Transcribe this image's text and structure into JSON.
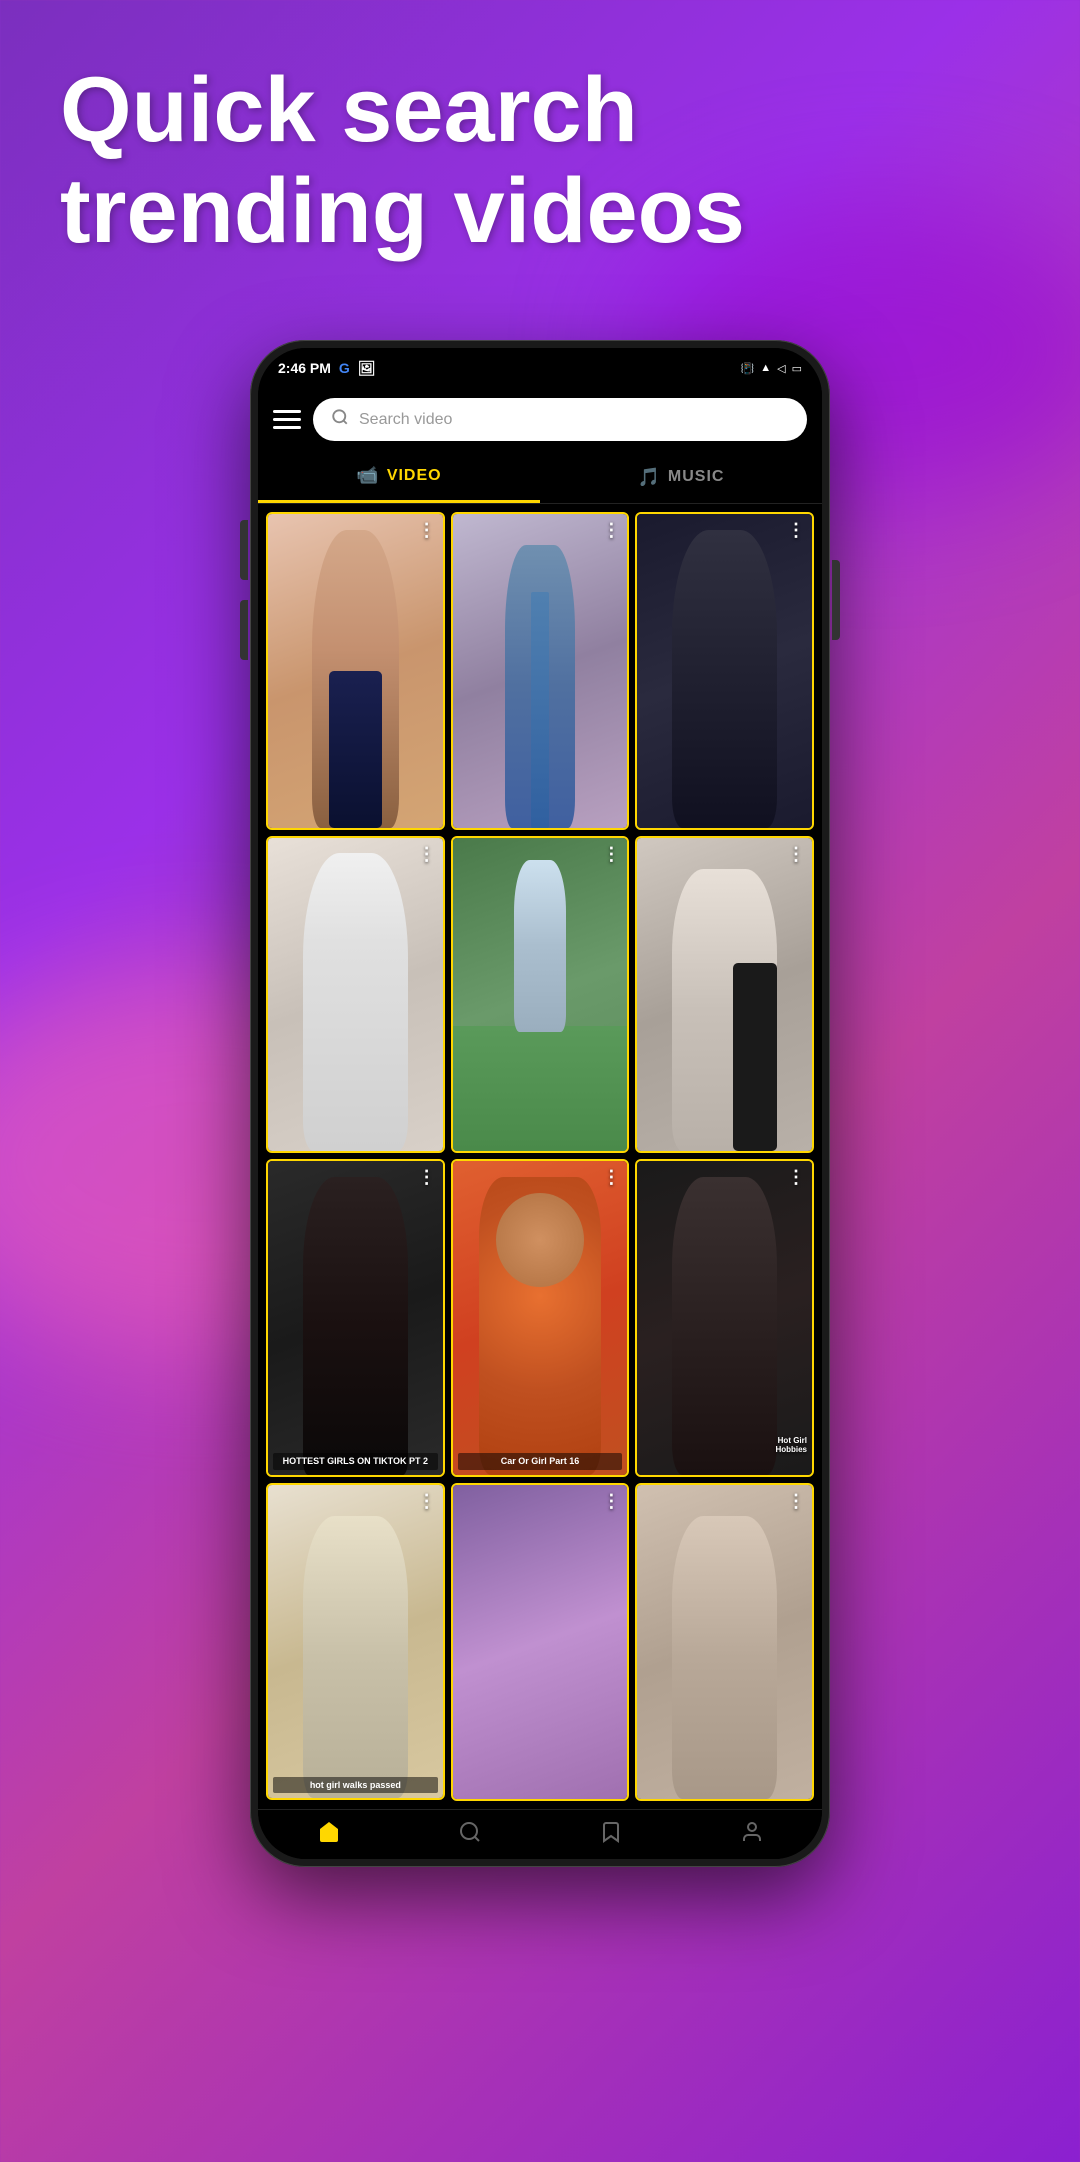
{
  "header": {
    "title": "Quick search trending videos"
  },
  "status_bar": {
    "time": "2:46 PM",
    "google_icon": "G",
    "notification_icon": "🖼",
    "icons": [
      "vibrate",
      "wifi",
      "signal",
      "signal2",
      "battery"
    ]
  },
  "search": {
    "placeholder": "Search video"
  },
  "tabs": [
    {
      "id": "video",
      "label": "VIDEO",
      "icon": "🎬",
      "active": true
    },
    {
      "id": "music",
      "label": "MUSIC",
      "icon": "🎵",
      "active": false
    }
  ],
  "videos": [
    {
      "id": 1,
      "thumb_class": "thumb-1",
      "overlay": "",
      "has_more": true
    },
    {
      "id": 2,
      "thumb_class": "thumb-2",
      "overlay": "",
      "has_more": true
    },
    {
      "id": 3,
      "thumb_class": "thumb-3",
      "overlay": "",
      "has_more": true
    },
    {
      "id": 4,
      "thumb_class": "thumb-4",
      "overlay": "",
      "has_more": true
    },
    {
      "id": 5,
      "thumb_class": "thumb-5",
      "overlay": "",
      "has_more": true
    },
    {
      "id": 6,
      "thumb_class": "thumb-6",
      "overlay": "",
      "has_more": true
    },
    {
      "id": 7,
      "thumb_class": "thumb-7",
      "overlay": "HOTTEST GIRLS ON TIKTOK PT 2",
      "has_more": true
    },
    {
      "id": 8,
      "thumb_class": "thumb-8",
      "overlay": "Car Or Girl Part 16",
      "has_more": true
    },
    {
      "id": 9,
      "thumb_class": "thumb-9",
      "overlay": "Hot Girl Hobbies",
      "has_more": true
    },
    {
      "id": 10,
      "thumb_class": "thumb-10",
      "overlay": "hot girl walks passed",
      "has_more": true
    },
    {
      "id": 11,
      "thumb_class": "thumb-11",
      "overlay": "",
      "has_more": true
    },
    {
      "id": 12,
      "thumb_class": "thumb-12",
      "overlay": "",
      "has_more": true
    }
  ],
  "bottom_nav": [
    {
      "id": "home",
      "icon": "⊞",
      "active": true
    },
    {
      "id": "explore",
      "icon": "◎",
      "active": false
    },
    {
      "id": "bookmark",
      "icon": "🔖",
      "active": false
    },
    {
      "id": "profile",
      "icon": "👤",
      "active": false
    }
  ],
  "more_icon": "⋮",
  "hamburger_lines": 3,
  "colors": {
    "background_start": "#7B2FBE",
    "background_end": "#C040A0",
    "active_tab_color": "#FFD700",
    "app_bg": "#000000",
    "phone_body": "#1a1a1a",
    "search_bg": "#FFFFFF"
  }
}
